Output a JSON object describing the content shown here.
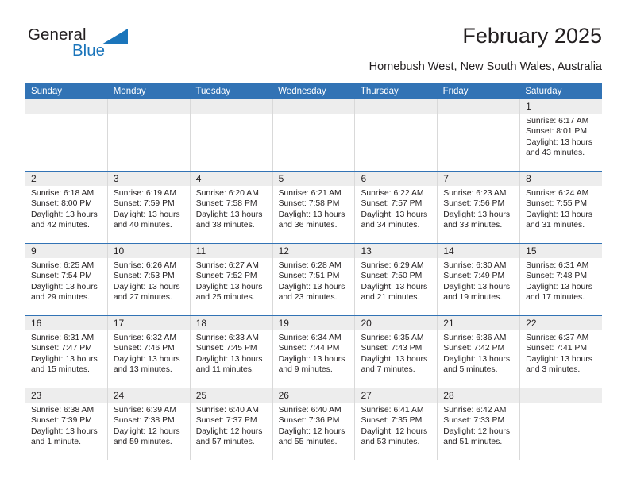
{
  "brand": {
    "name_part1": "General",
    "name_part2": "Blue",
    "accent_color": "#1b75bb"
  },
  "header": {
    "title": "February 2025",
    "subtitle": "Homebush West, New South Wales, Australia"
  },
  "calendar": {
    "header_bg": "#3273b5",
    "daynum_band_bg": "#ededed",
    "weekday_headers": [
      "Sunday",
      "Monday",
      "Tuesday",
      "Wednesday",
      "Thursday",
      "Friday",
      "Saturday"
    ],
    "weeks": [
      [
        {
          "day": "",
          "empty": true
        },
        {
          "day": "",
          "empty": true
        },
        {
          "day": "",
          "empty": true
        },
        {
          "day": "",
          "empty": true
        },
        {
          "day": "",
          "empty": true
        },
        {
          "day": "",
          "empty": true
        },
        {
          "day": "1",
          "sunrise": "Sunrise: 6:17 AM",
          "sunset": "Sunset: 8:01 PM",
          "daylight": "Daylight: 13 hours and 43 minutes."
        }
      ],
      [
        {
          "day": "2",
          "sunrise": "Sunrise: 6:18 AM",
          "sunset": "Sunset: 8:00 PM",
          "daylight": "Daylight: 13 hours and 42 minutes."
        },
        {
          "day": "3",
          "sunrise": "Sunrise: 6:19 AM",
          "sunset": "Sunset: 7:59 PM",
          "daylight": "Daylight: 13 hours and 40 minutes."
        },
        {
          "day": "4",
          "sunrise": "Sunrise: 6:20 AM",
          "sunset": "Sunset: 7:58 PM",
          "daylight": "Daylight: 13 hours and 38 minutes."
        },
        {
          "day": "5",
          "sunrise": "Sunrise: 6:21 AM",
          "sunset": "Sunset: 7:58 PM",
          "daylight": "Daylight: 13 hours and 36 minutes."
        },
        {
          "day": "6",
          "sunrise": "Sunrise: 6:22 AM",
          "sunset": "Sunset: 7:57 PM",
          "daylight": "Daylight: 13 hours and 34 minutes."
        },
        {
          "day": "7",
          "sunrise": "Sunrise: 6:23 AM",
          "sunset": "Sunset: 7:56 PM",
          "daylight": "Daylight: 13 hours and 33 minutes."
        },
        {
          "day": "8",
          "sunrise": "Sunrise: 6:24 AM",
          "sunset": "Sunset: 7:55 PM",
          "daylight": "Daylight: 13 hours and 31 minutes."
        }
      ],
      [
        {
          "day": "9",
          "sunrise": "Sunrise: 6:25 AM",
          "sunset": "Sunset: 7:54 PM",
          "daylight": "Daylight: 13 hours and 29 minutes."
        },
        {
          "day": "10",
          "sunrise": "Sunrise: 6:26 AM",
          "sunset": "Sunset: 7:53 PM",
          "daylight": "Daylight: 13 hours and 27 minutes."
        },
        {
          "day": "11",
          "sunrise": "Sunrise: 6:27 AM",
          "sunset": "Sunset: 7:52 PM",
          "daylight": "Daylight: 13 hours and 25 minutes."
        },
        {
          "day": "12",
          "sunrise": "Sunrise: 6:28 AM",
          "sunset": "Sunset: 7:51 PM",
          "daylight": "Daylight: 13 hours and 23 minutes."
        },
        {
          "day": "13",
          "sunrise": "Sunrise: 6:29 AM",
          "sunset": "Sunset: 7:50 PM",
          "daylight": "Daylight: 13 hours and 21 minutes."
        },
        {
          "day": "14",
          "sunrise": "Sunrise: 6:30 AM",
          "sunset": "Sunset: 7:49 PM",
          "daylight": "Daylight: 13 hours and 19 minutes."
        },
        {
          "day": "15",
          "sunrise": "Sunrise: 6:31 AM",
          "sunset": "Sunset: 7:48 PM",
          "daylight": "Daylight: 13 hours and 17 minutes."
        }
      ],
      [
        {
          "day": "16",
          "sunrise": "Sunrise: 6:31 AM",
          "sunset": "Sunset: 7:47 PM",
          "daylight": "Daylight: 13 hours and 15 minutes."
        },
        {
          "day": "17",
          "sunrise": "Sunrise: 6:32 AM",
          "sunset": "Sunset: 7:46 PM",
          "daylight": "Daylight: 13 hours and 13 minutes."
        },
        {
          "day": "18",
          "sunrise": "Sunrise: 6:33 AM",
          "sunset": "Sunset: 7:45 PM",
          "daylight": "Daylight: 13 hours and 11 minutes."
        },
        {
          "day": "19",
          "sunrise": "Sunrise: 6:34 AM",
          "sunset": "Sunset: 7:44 PM",
          "daylight": "Daylight: 13 hours and 9 minutes."
        },
        {
          "day": "20",
          "sunrise": "Sunrise: 6:35 AM",
          "sunset": "Sunset: 7:43 PM",
          "daylight": "Daylight: 13 hours and 7 minutes."
        },
        {
          "day": "21",
          "sunrise": "Sunrise: 6:36 AM",
          "sunset": "Sunset: 7:42 PM",
          "daylight": "Daylight: 13 hours and 5 minutes."
        },
        {
          "day": "22",
          "sunrise": "Sunrise: 6:37 AM",
          "sunset": "Sunset: 7:41 PM",
          "daylight": "Daylight: 13 hours and 3 minutes."
        }
      ],
      [
        {
          "day": "23",
          "sunrise": "Sunrise: 6:38 AM",
          "sunset": "Sunset: 7:39 PM",
          "daylight": "Daylight: 13 hours and 1 minute."
        },
        {
          "day": "24",
          "sunrise": "Sunrise: 6:39 AM",
          "sunset": "Sunset: 7:38 PM",
          "daylight": "Daylight: 12 hours and 59 minutes."
        },
        {
          "day": "25",
          "sunrise": "Sunrise: 6:40 AM",
          "sunset": "Sunset: 7:37 PM",
          "daylight": "Daylight: 12 hours and 57 minutes."
        },
        {
          "day": "26",
          "sunrise": "Sunrise: 6:40 AM",
          "sunset": "Sunset: 7:36 PM",
          "daylight": "Daylight: 12 hours and 55 minutes."
        },
        {
          "day": "27",
          "sunrise": "Sunrise: 6:41 AM",
          "sunset": "Sunset: 7:35 PM",
          "daylight": "Daylight: 12 hours and 53 minutes."
        },
        {
          "day": "28",
          "sunrise": "Sunrise: 6:42 AM",
          "sunset": "Sunset: 7:33 PM",
          "daylight": "Daylight: 12 hours and 51 minutes."
        },
        {
          "day": "",
          "empty": true
        }
      ]
    ]
  }
}
